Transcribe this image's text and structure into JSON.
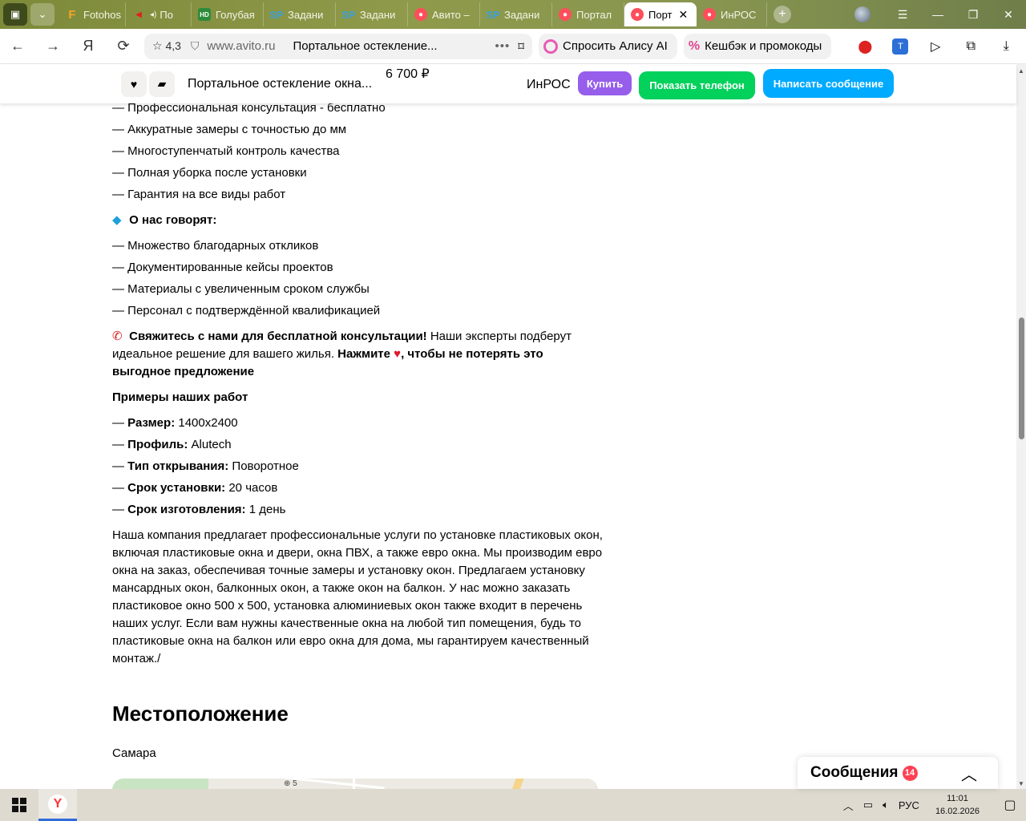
{
  "browser": {
    "tabs": [
      {
        "label": "Fotohos",
        "fav": "F",
        "type": "f"
      },
      {
        "label": "По",
        "fav": "◀",
        "type": "red",
        "muted": true
      },
      {
        "label": "Голубая",
        "fav": "HD",
        "type": "hd"
      },
      {
        "label": "Задани",
        "fav": "SP",
        "type": "sp"
      },
      {
        "label": "Задани",
        "fav": "SP",
        "type": "sp"
      },
      {
        "label": "Авито –",
        "fav": "●",
        "type": "avito"
      },
      {
        "label": "Задани",
        "fav": "SP",
        "type": "sp"
      },
      {
        "label": "Портал",
        "fav": "●",
        "type": "avito"
      },
      {
        "label": "Порт",
        "fav": "●",
        "type": "avito",
        "active": true
      },
      {
        "label": "ИнРОС",
        "fav": "●",
        "type": "avito"
      }
    ],
    "toolbar": {
      "rating": "4,3",
      "domain": "www.avito.ru",
      "page_title": "Портальное остекление...",
      "alice_label": "Спросить Алису AI",
      "cashback_label": "Кешбэк и промокоды"
    }
  },
  "sticky": {
    "title": "Портальное остекление окна...",
    "price": "6 700 ₽",
    "seller": "ИнРОС",
    "buy_label": "Купить",
    "phone_label": "Показать телефон",
    "message_label": "Написать сообщение"
  },
  "content": {
    "advantages": [
      "— Профессиональная консультация - бесплатно",
      "— Аккуратные замеры с точностью до мм",
      "— Многоступенчатый контроль качества",
      "— Полная уборка после установки",
      "— Гарантия на все виды работ"
    ],
    "reviews_heading": "О нас говорят:",
    "reviews_icon": "diamond-icon",
    "reviews": [
      "— Множество благодарных откликов",
      "— Документированные кейсы проектов",
      "— Материалы с увеличенным сроком службы",
      "— Персонал с подтверждённой квалификацией"
    ],
    "cta_bold": "Свяжитесь с нами для бесплатной консультации!",
    "cta_text": "Наши эксперты подберут идеальное решение для вашего жилья.",
    "cta_press": "Нажмите",
    "cta_tail": ", чтобы не потерять это выгодное предложение",
    "examples_heading": "Примеры наших работ",
    "specs": [
      {
        "label": "Размер:",
        "value": "1400х2400"
      },
      {
        "label": "Профиль:",
        "value": "Alutech"
      },
      {
        "label": "Тип открывания:",
        "value": "Поворотное"
      },
      {
        "label": "Срок установки:",
        "value": "20 часов"
      },
      {
        "label": "Срок изготовления:",
        "value": "1 день"
      }
    ],
    "description": "Наша компания предлагает профессиональные услуги по установке пластиковых окон, включая пластиковые окна и двери, окна ПВХ, а также евро окна. Мы производим евро окна на заказ, обеспечивая точные замеры и установку окон. Предлагаем установку мансардных окон, балконных окон, а также окон на балкон. У нас можно заказать пластиковое окно 500 х 500, установка алюминиевых окон также входит в перечень наших услуг. Если вам нужны качественные окна на любой тип помещения, будь то пластиковые окна на балкон или евро окна для дома, мы гарантируем качественный монтаж./",
    "location_heading": "Местоположение",
    "city": "Самара",
    "map_label": "5"
  },
  "messages": {
    "label": "Сообщения",
    "count": "14"
  },
  "taskbar": {
    "lang": "РУС",
    "time": "11:01",
    "date": "16.02.2026"
  },
  "colors": {
    "buy": "#965eeb",
    "phone": "#02d15c",
    "message": "#00aaff",
    "badge": "#ff4053"
  }
}
